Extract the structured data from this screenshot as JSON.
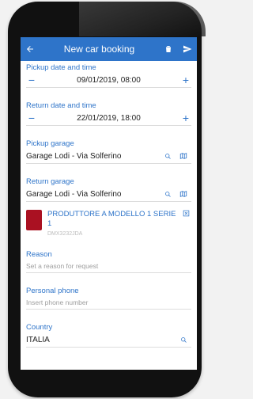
{
  "header": {
    "title": "New car booking"
  },
  "pickup": {
    "label": "Pickup date and time",
    "value": "09/01/2019, 08:00"
  },
  "return": {
    "label": "Return date and time",
    "value": "22/01/2019, 18:00"
  },
  "pickup_garage": {
    "label": "Pickup garage",
    "value": "Garage Lodi - Via Solferino"
  },
  "return_garage": {
    "label": "Return garage",
    "value": "Garage Lodi - Via Solferino"
  },
  "car": {
    "name": "PRODUTTORE A MODELLO 1 SERIE 1",
    "plate": "DMX3232JDA"
  },
  "reason": {
    "label": "Reason",
    "placeholder": "Set a reason for request"
  },
  "phone": {
    "label": "Personal phone",
    "placeholder": "Insert phone number"
  },
  "country": {
    "label": "Country",
    "value": "ITALIA"
  },
  "colors": {
    "accent": "#2e74c9",
    "divider": "#dcdcdc",
    "muted": "#9e9e9e"
  }
}
